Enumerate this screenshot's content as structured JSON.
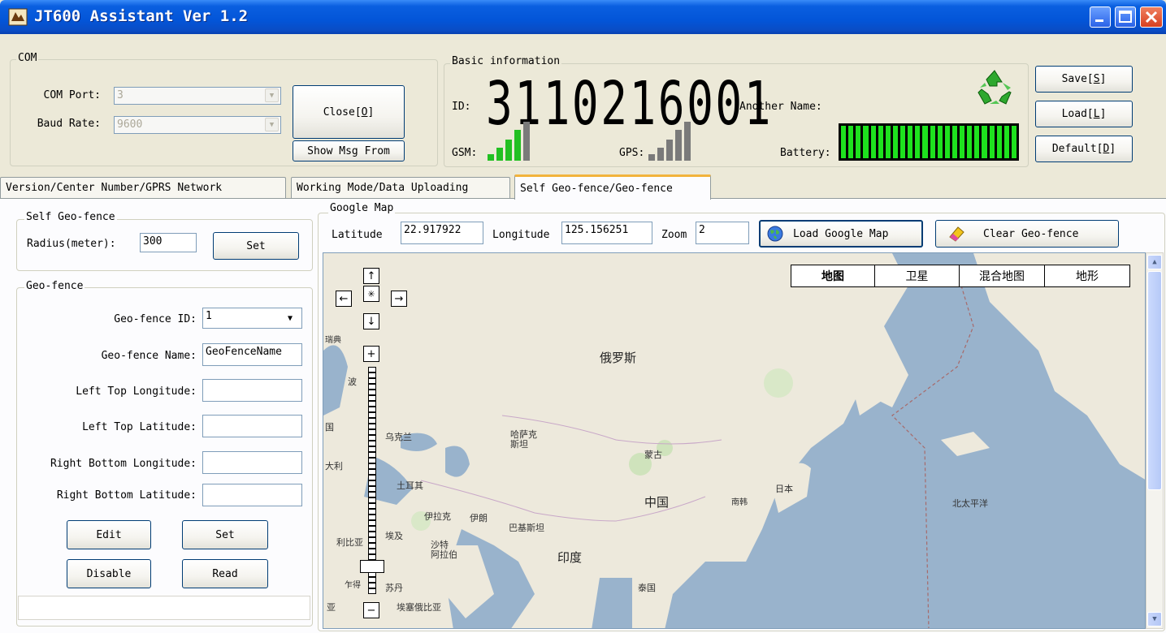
{
  "window": {
    "title": "JT600 Assistant Ver 1.2"
  },
  "com": {
    "group_label": "COM",
    "port_label": "COM Port:",
    "port_value": "3",
    "baud_label": "Baud Rate:",
    "baud_value": "9600",
    "close_label": "Close[",
    "close_key": "O",
    "close_end": "]",
    "show_msg_label": "Show Msg From"
  },
  "basic": {
    "group_label": "Basic information",
    "id_label": "ID:",
    "id_value": "3110216001",
    "another_name_label": "Another Name:",
    "gsm_label": "GSM:",
    "gps_label": "GPS:",
    "battery_label": "Battery:",
    "gsm_level": 3,
    "gps_level": 0,
    "battery_level": 1.0
  },
  "actions": {
    "save_label": "Save[",
    "save_key": "S",
    "save_end": "]",
    "load_label": "Load[",
    "load_key": "L",
    "load_end": "]",
    "default_label": "Default[",
    "default_key": "D",
    "default_end": "]"
  },
  "tabs": [
    {
      "label": "Version/Center Number/GPRS Network"
    },
    {
      "label": "Working Mode/Data Uploading"
    },
    {
      "label": "Self Geo-fence/Geo-fence"
    }
  ],
  "self_geofence": {
    "group_label": "Self Geo-fence",
    "radius_label": "Radius(meter):",
    "radius_value": "300",
    "set_label": "Set"
  },
  "geofence": {
    "group_label": "Geo-fence",
    "id_label": "Geo-fence ID:",
    "id_value": "1",
    "name_label": "Geo-fence Name:",
    "name_value": "GeoFenceName",
    "lt_lon_label": "Left Top Longitude:",
    "lt_lon_value": "",
    "lt_lat_label": "Left Top Latitude:",
    "lt_lat_value": "",
    "rb_lon_label": "Right Bottom Longitude:",
    "rb_lon_value": "",
    "rb_lat_label": "Right Bottom Latitude:",
    "rb_lat_value": "",
    "edit_label": "Edit",
    "set_label": "Set",
    "disable_label": "Disable",
    "read_label": "Read"
  },
  "map_panel": {
    "group_label": "Google Map",
    "latitude_label": "Latitude",
    "latitude_value": "22.917922",
    "longitude_label": "Longitude",
    "longitude_value": "125.156251",
    "zoom_label": "Zoom",
    "zoom_value": "2",
    "load_map_label": "Load Google Map",
    "clear_label": "Clear Geo-fence",
    "map_types": [
      "地图",
      "卫星",
      "混合地图",
      "地形"
    ],
    "places": {
      "russia": "俄罗斯",
      "kazakhstan": "哈萨克\n斯坦",
      "mongolia": "蒙古",
      "china": "中国",
      "japan": "日本",
      "south_korea": "南韩",
      "india": "印度",
      "pakistan": "巴基斯坦",
      "iran": "伊朗",
      "iraq": "伊拉克",
      "saudi": "沙特\n阿拉伯",
      "egypt": "埃及",
      "turkey": "土耳其",
      "ukraine": "乌克兰",
      "thailand": "泰国",
      "sudan": "苏丹",
      "ethiopia": "埃塞俄比亚",
      "libya": "利比亚",
      "north_pacific": "北太平洋",
      "sweden": "瑞典",
      "poland": "波",
      "germany": "国",
      "italy": "大利",
      "chad": "乍得",
      "nigeria": "亚"
    }
  },
  "colors": {
    "title_bar": "#0355d8",
    "battery": "#1ee21e",
    "signal": "#22c022",
    "tab_accent": "#f2b33c"
  }
}
